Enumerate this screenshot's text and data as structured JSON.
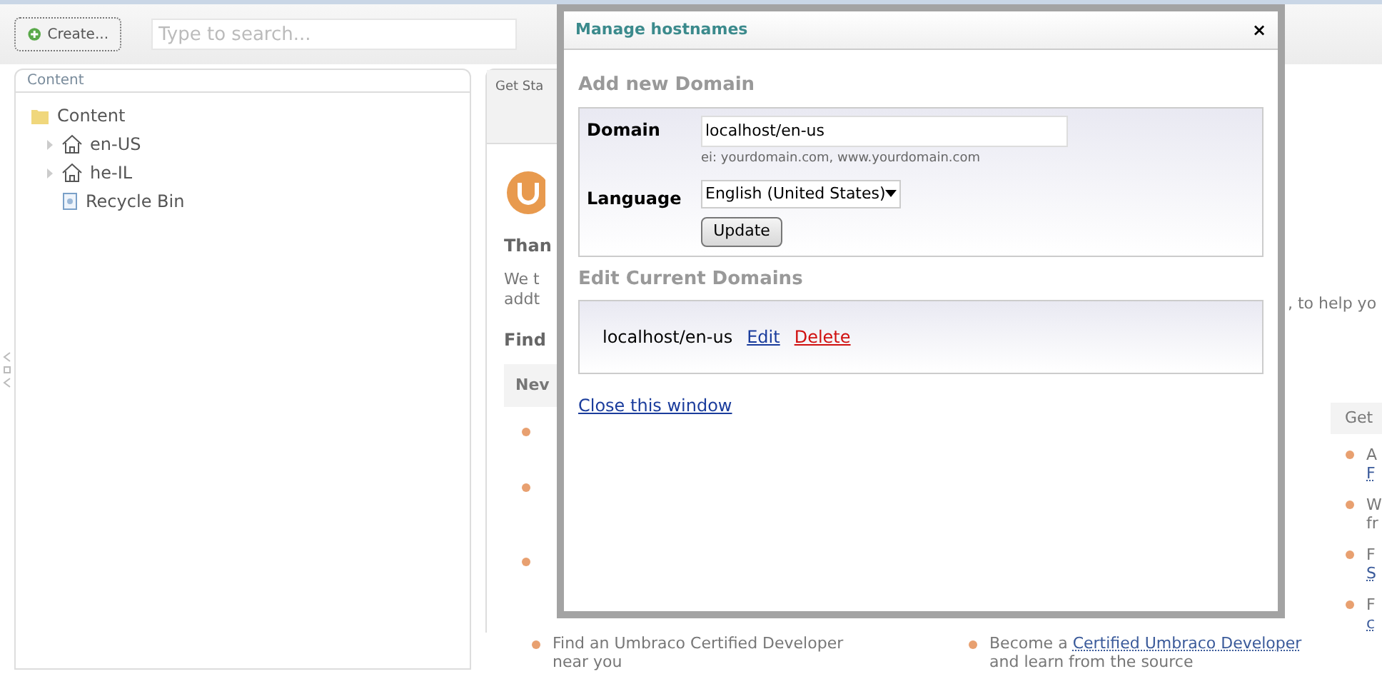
{
  "toolbar": {
    "create_button": "Create...",
    "search": {
      "placeholder": "Type to search..."
    }
  },
  "content_tree": {
    "title": "Content",
    "items": [
      {
        "label": "Content",
        "kind": "folder",
        "children": [
          {
            "label": "en-US",
            "kind": "site",
            "expandable": true
          },
          {
            "label": "he-IL",
            "kind": "site",
            "expandable": true
          },
          {
            "label": "Recycle Bin",
            "kind": "bin",
            "expandable": false
          }
        ]
      }
    ]
  },
  "dashboard": {
    "tab": "Get Sta",
    "left_fragments": [
      {
        "text": "Than",
        "kind": "heading"
      },
      {
        "text": "We t",
        "kind": "body"
      },
      {
        "text": "addt",
        "kind": "body"
      },
      {
        "text": "Find",
        "kind": "heading"
      }
    ],
    "right_fragment": ", to help yo",
    "section_left": "Nev",
    "section_right": "Get",
    "right_bullets": [
      {
        "lines": [
          {
            "text": "A",
            "link": false
          },
          {
            "text": "F",
            "link": true
          }
        ]
      },
      {
        "lines": [
          {
            "text": "W",
            "link": false
          },
          {
            "text": "fr",
            "link": false
          }
        ]
      },
      {
        "lines": [
          {
            "text": "F",
            "link": false
          },
          {
            "text": "S",
            "link": true
          }
        ]
      },
      {
        "lines": [
          {
            "text": "F",
            "link": false
          },
          {
            "text": "c",
            "link": true
          }
        ]
      }
    ],
    "bottom_items": [
      {
        "before": "Find an Umbraco Certified Developer near you"
      },
      {
        "before": "Become a",
        "link": "Certified Umbraco Developer",
        "after": "and learn from the source"
      }
    ]
  },
  "dialog": {
    "title": "Manage hostnames",
    "close": "×",
    "add_heading": "Add new Domain",
    "domain_label": "Domain",
    "domain_value": "localhost/en-us",
    "domain_hint": "ei: yourdomain.com, www.yourdomain.com",
    "language_label": "Language",
    "language_value": "English (United States)",
    "update_button": "Update",
    "edit_heading": "Edit Current Domains",
    "domains": [
      {
        "name": "localhost/en-us",
        "edit": "Edit",
        "delete": "Delete"
      }
    ],
    "close_link": "Close this window"
  }
}
